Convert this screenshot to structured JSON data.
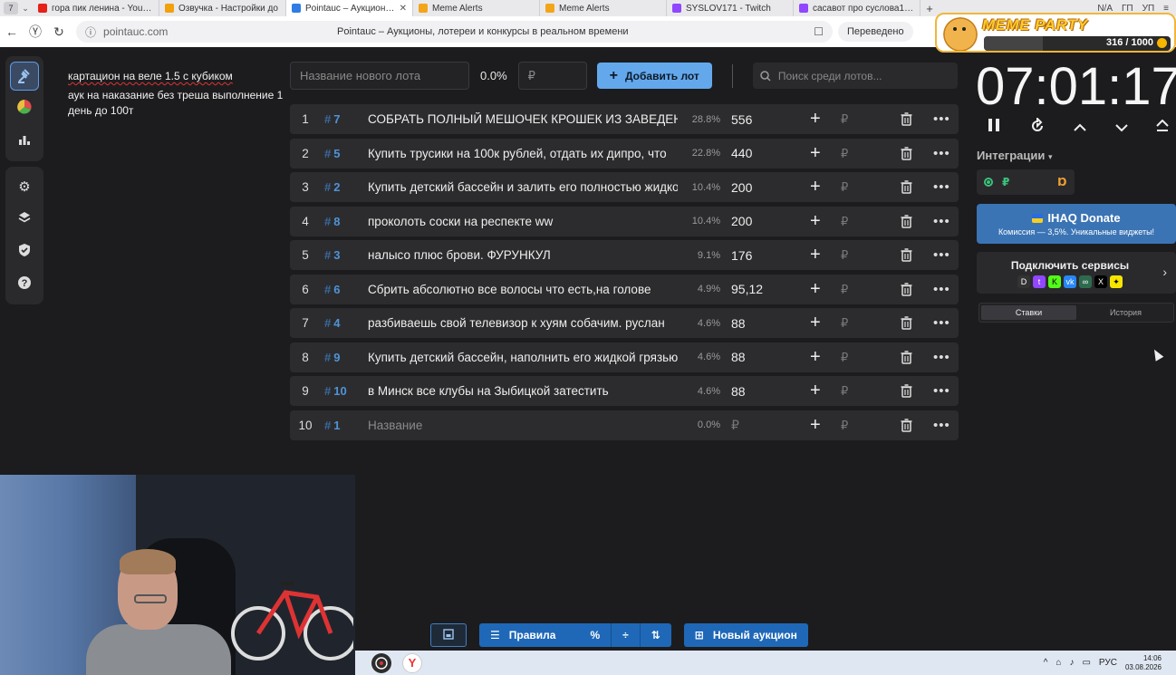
{
  "browser": {
    "tab_count": "7",
    "tabs": [
      {
        "title": "гора пик ленина - YouTube",
        "color": "#e62117",
        "active": false
      },
      {
        "title": "Озвучка - Настройки до",
        "color": "#f1a10a",
        "active": false
      },
      {
        "title": "Pointauc – Аукционы, л",
        "color": "#2f7ce4",
        "active": true
      },
      {
        "title": "Meme Alerts",
        "color": "#f3a51a",
        "active": false
      },
      {
        "title": "Meme Alerts",
        "color": "#f3a51a",
        "active": false
      },
      {
        "title": "SYSLOV171 - Twitch",
        "color": "#9146ff",
        "active": false
      },
      {
        "title": "сасавот про суслова171 -",
        "color": "#9146ff",
        "active": false
      }
    ],
    "tab_right": [
      "N/A",
      "ГП",
      "УП"
    ],
    "url": "pointauc.com",
    "page_title": "Pointauc – Аукционы, лотереи и конкурсы в реальном времени",
    "translate_label": "Переведено"
  },
  "overlay": {
    "brand": "MEME PARTY",
    "count": "316 / 1000",
    "progress": 0.316
  },
  "notes": [
    "картацион на веле 1.5 с кубиком",
    "аук на наказание без треша выполнение 1 день до 100т"
  ],
  "controls": {
    "name_placeholder": "Название нового лота",
    "percent": "0.0%",
    "amount_placeholder": "₽",
    "add_label": "Добавить лот",
    "search_placeholder": "Поиск среди лотов..."
  },
  "lots": [
    {
      "n": "1",
      "id": "7",
      "name": "СОБРАТЬ ПОЛНЫЙ МЕШОЧЕК КРОШЕК ИЗ ЗАВЕДЕНИЯ",
      "percent": "28.8%",
      "amount": "556"
    },
    {
      "n": "2",
      "id": "5",
      "name": "Купить трусики на 100к рублей, отдать их дипро, что",
      "percent": "22.8%",
      "amount": "440"
    },
    {
      "n": "3",
      "id": "2",
      "name": "Купить детский бассейн и залить его полностью жидкостью",
      "percent": "10.4%",
      "amount": "200"
    },
    {
      "n": "4",
      "id": "8",
      "name": "проколоть соски на респекте ww",
      "percent": "10.4%",
      "amount": "200"
    },
    {
      "n": "5",
      "id": "3",
      "name": "налысо плюс брови. ФУРУНКУЛ",
      "percent": "9.1%",
      "amount": "176"
    },
    {
      "n": "6",
      "id": "6",
      "name": "Сбрить абсолютно все волосы что есть,на голове",
      "percent": "4.9%",
      "amount": "95,12"
    },
    {
      "n": "7",
      "id": "4",
      "name": "разбиваешь свой телевизор к хуям собачим. руслан",
      "percent": "4.6%",
      "amount": "88"
    },
    {
      "n": "8",
      "id": "9",
      "name": "Купить детский бассейн, наполнить его жидкой грязью",
      "percent": "4.6%",
      "amount": "88"
    },
    {
      "n": "9",
      "id": "10",
      "name": "в Минск все клубы на Зыбицкой затестить",
      "percent": "4.6%",
      "amount": "88"
    },
    {
      "n": "10",
      "id": "1",
      "name": "Название",
      "percent": "0.0%",
      "amount": "₽",
      "placeholder": true
    }
  ],
  "timer": {
    "value": "07:01:17"
  },
  "integrations": {
    "label": "Интеграции",
    "donate_title": "IHAQ Donate",
    "donate_sub": "Комиссия — 3,5%. Уникальные виджеты!",
    "connect_title": "Подключить сервисы",
    "tabs": [
      "Ставки",
      "История"
    ]
  },
  "bottom": {
    "rules_label": "Правила",
    "new_auction_label": "Новый аукцион"
  },
  "taskbar": {
    "lang": "РУС",
    "time": "14:06",
    "date": "03.08.2026"
  }
}
